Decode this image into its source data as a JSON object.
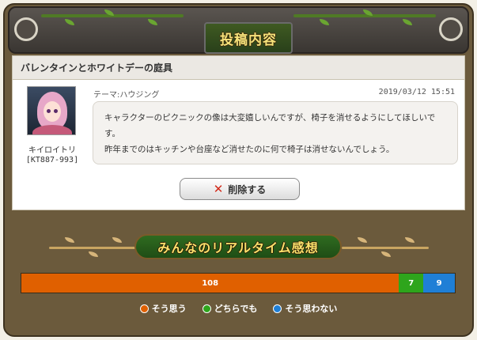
{
  "header": {
    "title": "投稿内容"
  },
  "post": {
    "title": "バレンタインとホワイトデーの庭具",
    "user": {
      "name": "キイロイトリ",
      "id": "[KT887-993]"
    },
    "theme": "テーマ:ハウジング",
    "date": "2019/03/12 15:51",
    "body_line1": "キャラクターのピクニックの像は大変嬉しいんですが、椅子を消せるようにしてほしいです。",
    "body_line2": "昨年までのはキッチンや台座など消せたのに何で椅子は消せないんでしょう。",
    "delete_label": "削除する"
  },
  "realtime": {
    "title": "みんなのリアルタイム感想",
    "legend": [
      "そう思う",
      "どちらでも",
      "そう思わない"
    ]
  },
  "chart_data": {
    "type": "bar",
    "orientation": "horizontal-stacked",
    "categories": [
      "そう思う",
      "どちらでも",
      "そう思わない"
    ],
    "values": [
      108,
      7,
      9
    ],
    "labels": [
      "108",
      "7",
      "9"
    ],
    "colors": [
      "#e06000",
      "#2ea51c",
      "#1f7fd6"
    ]
  }
}
